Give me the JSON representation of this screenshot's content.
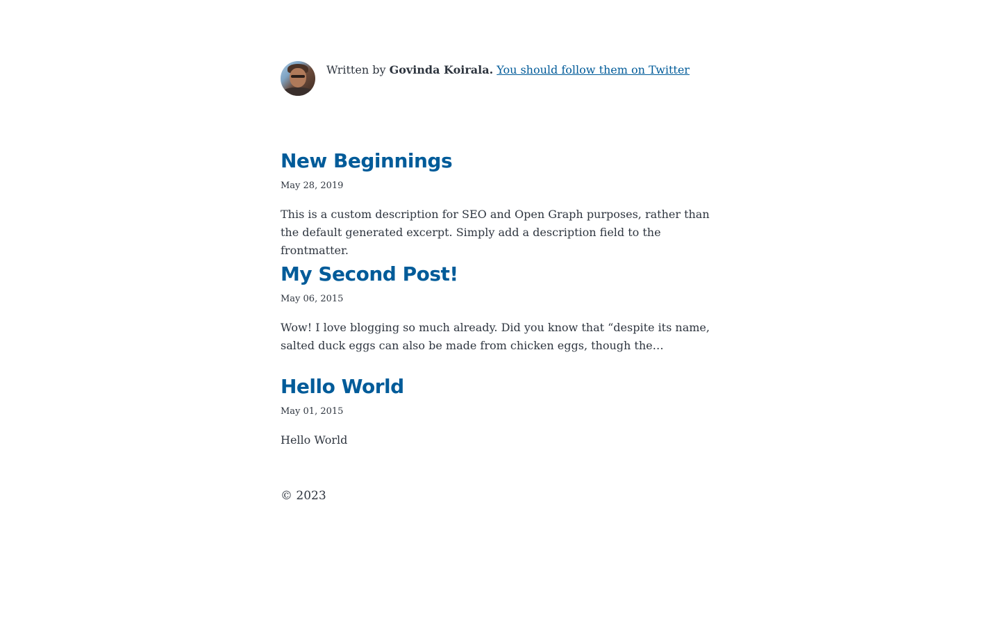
{
  "bio": {
    "written_by": "Written by ",
    "author": "Govinda Koirala.",
    "twitter_link": "You should follow them on Twitter",
    "avatar_alt": "Govinda Koirala"
  },
  "posts": [
    {
      "title": "New Beginnings",
      "date": "May 28, 2019",
      "description": "This is a custom description for SEO and Open Graph purposes, rather than the default generated excerpt. Simply add a description field to the frontmatter."
    },
    {
      "title": "My Second Post!",
      "date": "May 06, 2015",
      "description": "Wow! I love blogging so much already. Did you know that “despite its name, salted duck eggs can also be made from chicken eggs, though the…"
    },
    {
      "title": "Hello World",
      "date": "May 01, 2015",
      "description": "Hello World"
    }
  ],
  "footer": {
    "copyright": "© 2023"
  },
  "colors": {
    "link": "#005b99",
    "text": "#2e353f",
    "background": "#ffffff"
  }
}
